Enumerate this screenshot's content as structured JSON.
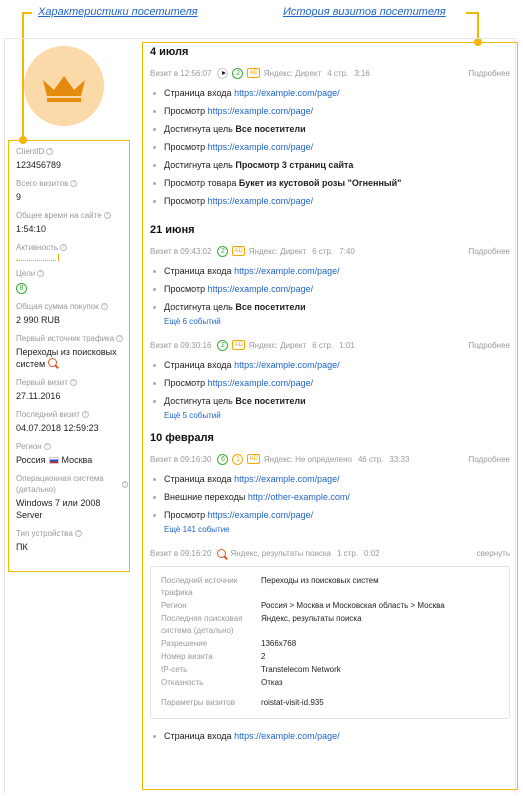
{
  "annotations": {
    "left": "Характеристики посетителя",
    "right": "История визитов посетителя"
  },
  "colors": {
    "accent": "#f5b800",
    "link": "#1f64c8",
    "green": "#3aaa35",
    "orange": "#f5a800"
  },
  "visitor": {
    "client_id_label": "ClientID",
    "client_id": "123456789",
    "visits_label": "Всего визитов",
    "visits": "9",
    "time_label": "Общее время на сайте",
    "time": "1:54:10",
    "activity_label": "Активность",
    "goals_label": "Цели",
    "goals": "8",
    "purchases_label": "Общая сумма покупок",
    "purchases": "2 990 RUB",
    "first_source_label": "Первый источник трафика",
    "first_source": "Переходы из поисковых систем",
    "first_visit_label": "Первый визит",
    "first_visit": "27.11.2016",
    "last_visit_label": "Последний визит",
    "last_visit": "04.07.2018 12:59:23",
    "region_label": "Регион",
    "region": "Россия",
    "region_city": "Москва",
    "os_label": "Операционная система (детально)",
    "os": "Windows 7 или 2008 Server",
    "device_label": "Тип устройства",
    "device": "ПК"
  },
  "history": {
    "s1": {
      "date": "4 июля",
      "head": {
        "time": "Визит в 12:56:07",
        "goals": "2",
        "ad": "AD",
        "source": "Яндекс: Директ",
        "pages": "4 стр.",
        "dur": "3:16",
        "more": "Подробнее"
      },
      "events": [
        {
          "pre": "Страница входа",
          "link": "https://example.com/page/"
        },
        {
          "pre": "Просмотр",
          "link": "https://example.com/page/"
        },
        {
          "pre": "Достигнута цель",
          "bold": "Все посетители"
        },
        {
          "pre": "Просмотр",
          "link": "https://example.com/page/"
        },
        {
          "pre": "Достигнута цель",
          "bold": "Просмотр 3 страниц сайта"
        },
        {
          "pre": "Просмотр товара",
          "bold": "Букет из кустовой розы \"Огненный\""
        },
        {
          "pre": "Просмотр",
          "link": "https://example.com/page/"
        }
      ]
    },
    "s2": {
      "date": "21 июня",
      "v1": {
        "head": {
          "time": "Визит в 09:43:02",
          "goals": "2",
          "ad": "AD",
          "source": "Яндекс: Директ",
          "pages": "6 стр.",
          "dur": "7:40",
          "more": "Подробнее"
        },
        "events": [
          {
            "pre": "Страница входа",
            "link": "https://example.com/page/"
          },
          {
            "pre": "Просмотр",
            "link": "https://example.com/page/"
          },
          {
            "pre": "Достигнута цель",
            "bold": "Все посетители"
          }
        ],
        "more_events": "Ещё 6 событий"
      },
      "v2": {
        "head": {
          "time": "Визит в 09:30:16",
          "goals": "2",
          "ad": "AD",
          "source": "Яндекс: Директ",
          "pages": "6 стр.",
          "dur": "1:01",
          "more": "Подробнее"
        },
        "events": [
          {
            "pre": "Страница входа",
            "link": "https://example.com/page/"
          },
          {
            "pre": "Просмотр",
            "link": "https://example.com/page/"
          },
          {
            "pre": "Достигнута цель",
            "bold": "Все посетители"
          }
        ],
        "more_events": "Ещё 5 событий"
      }
    },
    "s3": {
      "date": "10 февраля",
      "v1": {
        "head": {
          "time": "Визит в 09:16:30",
          "goals": "6",
          "goals2": "1",
          "ad": "AD",
          "source": "Яндекс: Не определено",
          "pages": "46 стр.",
          "dur": "33:33",
          "more": "Подробнее"
        },
        "events": [
          {
            "pre": "Страница входа",
            "link": "https://example.com/page/"
          },
          {
            "pre": "Внешние переходы",
            "link": "http://other-example.com/"
          },
          {
            "pre": "Просмотр",
            "link": "https://example.com/page/"
          }
        ],
        "more_events": "Ещё 141 событие"
      },
      "v2": {
        "head": {
          "time": "Визит в 09:16:20",
          "source": "Яндекс, результаты поиска",
          "pages": "1 стр.",
          "dur": "0:02",
          "collapse": "свернуть"
        },
        "details": [
          {
            "k": "Последний источник трафика",
            "v": "Переходы из поисковых систем"
          },
          {
            "k": "Регион",
            "v": "Россия > Москва и Московская область > Москва"
          },
          {
            "k": "Последняя поисковая система (детально)",
            "v": "Яндекс, результаты поиска"
          },
          {
            "k": "Разрешение",
            "v": "1366x768"
          },
          {
            "k": "Номер визита",
            "v": "2"
          },
          {
            "k": "IP-сеть",
            "v": "Transtelecom Network"
          },
          {
            "k": "Отказность",
            "v": "Отказ"
          },
          {
            "k": "Параметры визитов",
            "v": "roistat-visit-id.935"
          }
        ],
        "events": [
          {
            "pre": "Страница входа",
            "link": "https://example.com/page/"
          }
        ]
      }
    }
  }
}
